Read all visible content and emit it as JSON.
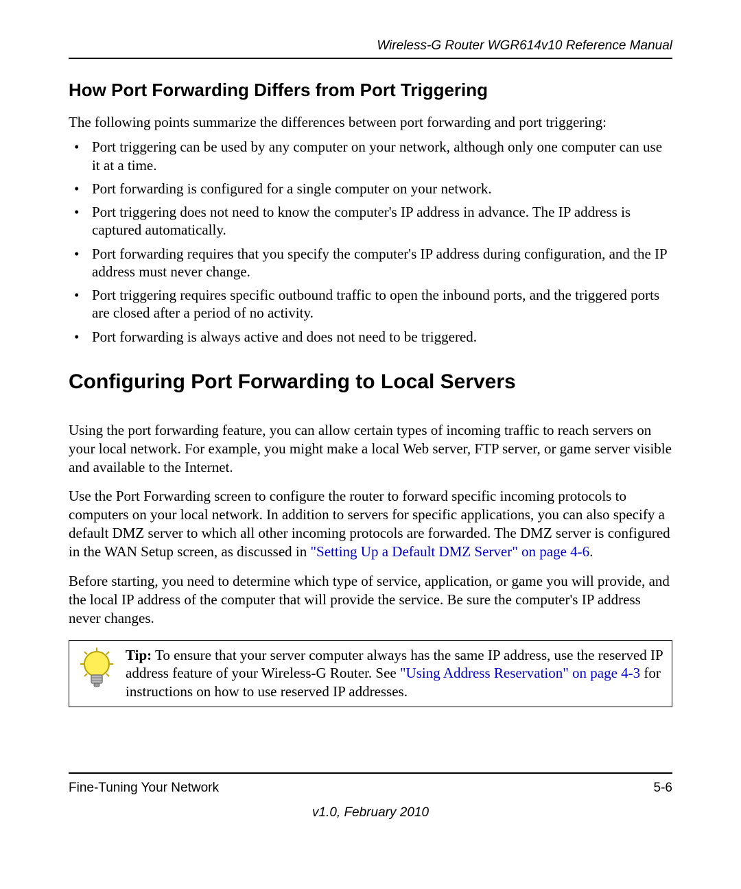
{
  "header": {
    "title": "Wireless-G Router WGR614v10 Reference Manual"
  },
  "section1": {
    "heading": "How Port Forwarding Differs from Port Triggering",
    "intro": "The following points summarize the differences between port forwarding and port triggering:",
    "bullets": [
      "Port triggering can be used by any computer on your network, although only one computer can use it at a time.",
      "Port forwarding is configured for a single computer on your network.",
      "Port triggering does not need to know the computer's IP address in advance. The IP address is captured automatically.",
      "Port forwarding requires that you specify the computer's IP address during configuration, and the IP address must never change.",
      "Port triggering requires specific outbound traffic to open the inbound ports, and the triggered ports are closed after a period of no activity.",
      "Port forwarding is always active and does not need to be triggered."
    ]
  },
  "section2": {
    "heading": "Configuring Port Forwarding to Local Servers",
    "para1": "Using the port forwarding feature, you can allow certain types of incoming traffic to reach servers on your local network. For example, you might make a local Web server, FTP server, or game server visible and available to the Internet.",
    "para2_pre": "Use the Port Forwarding screen to configure the router to forward specific incoming protocols to computers on your local network. In addition to servers for specific applications, you can also specify a default DMZ server to which all other incoming protocols are forwarded. The DMZ server is configured in the WAN Setup screen, as discussed in ",
    "para2_link": "\"Setting Up a Default DMZ Server\" on page 4-6",
    "para2_post": ".",
    "para3": "Before starting, you need to determine which type of service, application, or game you will provide, and the local IP address of the computer that will provide the service. Be sure the computer's IP address never changes."
  },
  "tip": {
    "label": "Tip:",
    "text_pre": " To ensure that your server computer always has the same IP address, use the reserved IP address feature of your Wireless-G Router. See ",
    "link": "\"Using Address Reservation\" on page 4-3",
    "text_post": " for instructions on how to use reserved IP addresses."
  },
  "footer": {
    "left": "Fine-Tuning Your Network",
    "right": "5-6",
    "version": "v1.0, February 2010"
  }
}
